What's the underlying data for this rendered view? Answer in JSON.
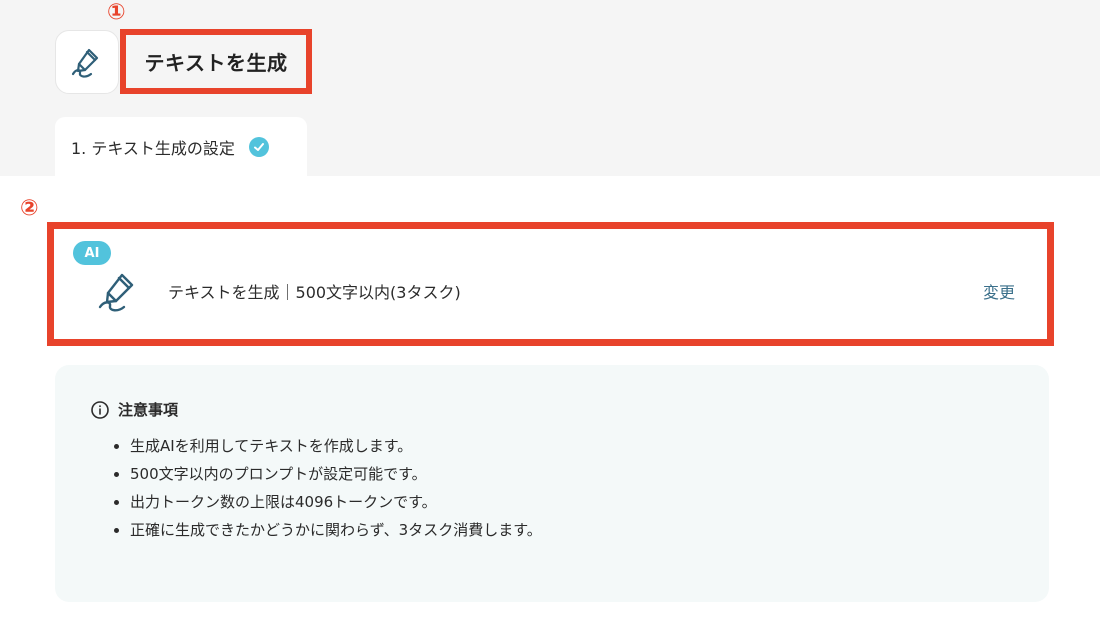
{
  "annotations": {
    "marker_1": "①",
    "marker_2": "②"
  },
  "header": {
    "app_title": "テキストを生成",
    "app_icon": "pen-squiggle-icon"
  },
  "steps": [
    {
      "label": "1. テキスト生成の設定",
      "status": "completed",
      "status_icon": "check-circle-icon"
    }
  ],
  "action_card": {
    "badge": "AI",
    "icon": "pen-squiggle-icon",
    "label": "テキストを生成｜500文字以内(3タスク)",
    "change_label": "変更"
  },
  "notes": {
    "title": "注意事項",
    "icon": "info-icon",
    "items": [
      "生成AIを利用してテキストを作成します。",
      "500文字以内のプロンプトが設定可能です。",
      "出力トークン数の上限は4096トークンです。",
      "正確に生成できたかどうかに関わらず、3タスク消費します。"
    ]
  },
  "colors": {
    "accent_red": "#e8432b",
    "badge_blue": "#52c3dc",
    "icon_teal": "#2f5f78",
    "link": "#3a6f8a"
  }
}
